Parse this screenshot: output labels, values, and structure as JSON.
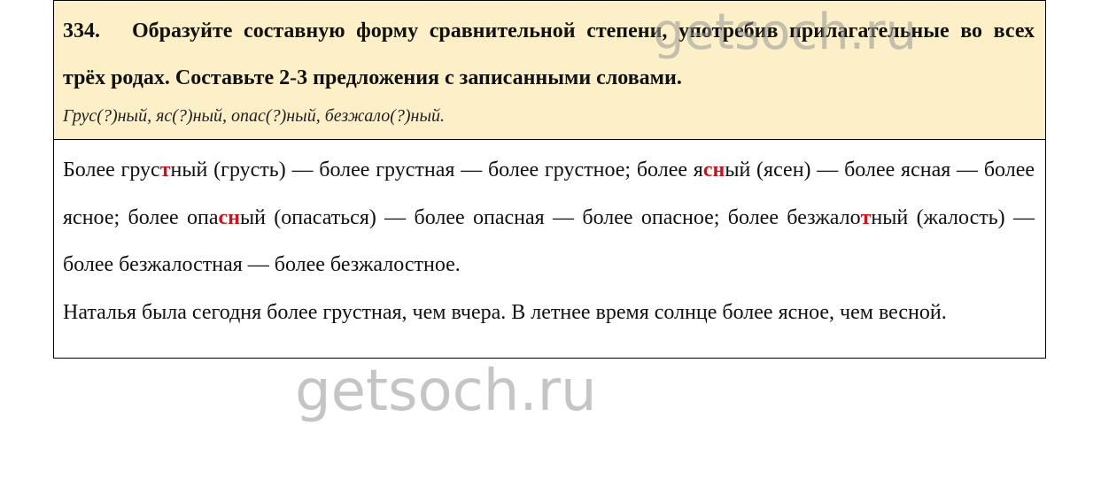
{
  "task": {
    "number": "334.",
    "instruction": "Образуйте составную форму сравнительной степени, употребив прилагательные во всех трёх родах. Составьте 2-3 предложения с записанными словами.",
    "words": "Грус(?)ный, яс(?)ный, опас(?)ный, безжало(?)ный."
  },
  "answer": {
    "p1_a": "Более грус",
    "p1_b": "т",
    "p1_c": "ный (грусть) — более грустная — более грустное; более я",
    "p1_d": "сн",
    "p1_e": "ый (ясен) — более ясная — более ясное; более опа",
    "p1_f": "сн",
    "p1_g": "ый (опасаться) — более опасная — более опасное; более безжало",
    "p1_h": "т",
    "p1_i": "ный (жалость) — более безжалостная — более безжалостное.",
    "p2": "Наталья была сегодня более грустная, чем вчера. В летнее время солнце более ясное, чем весной."
  },
  "watermark": {
    "text": "getsoch.ru"
  },
  "colors": {
    "task_bg": "#fdf0c8",
    "highlight": "#c8141e"
  }
}
